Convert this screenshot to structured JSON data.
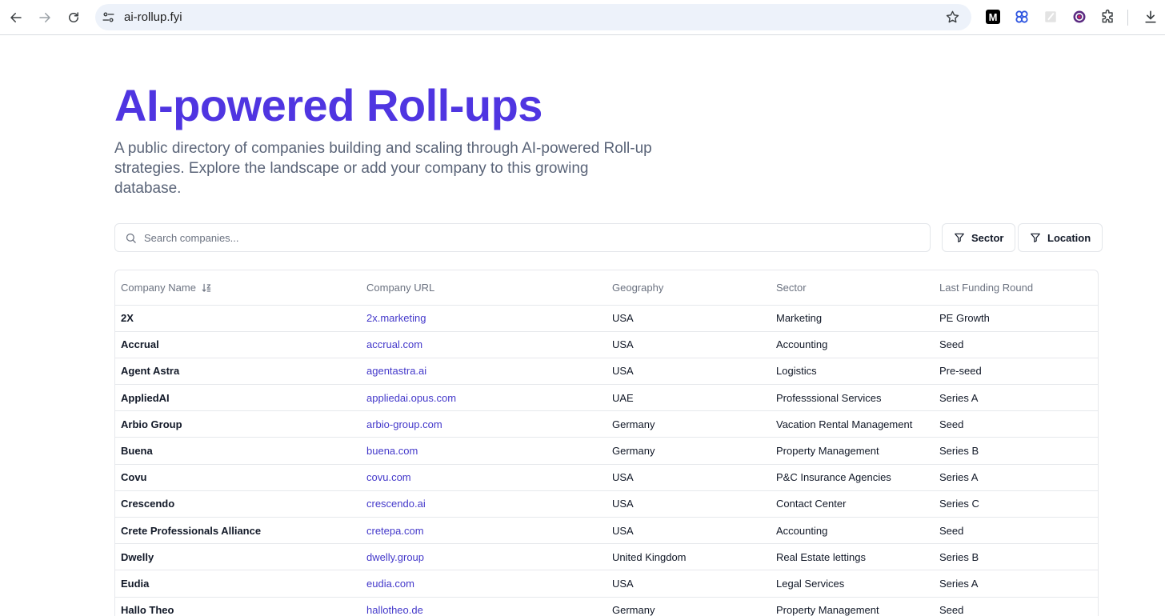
{
  "browser": {
    "url": "ai-rollup.fyi"
  },
  "hero": {
    "title": "AI-powered Roll-ups",
    "subtitle": "A public directory of companies building and scaling through AI-powered Roll-up strategies. Explore the landscape or add your company to this growing database."
  },
  "search": {
    "placeholder": "Search companies..."
  },
  "filters": {
    "sector_label": "Sector",
    "location_label": "Location"
  },
  "table": {
    "headers": {
      "name": "Company Name",
      "url": "Company URL",
      "geography": "Geography",
      "sector": "Sector",
      "funding": "Last Funding Round"
    },
    "rows": [
      {
        "name": "2X",
        "url": "2x.marketing",
        "geography": "USA",
        "sector": "Marketing",
        "funding": "PE Growth"
      },
      {
        "name": "Accrual",
        "url": "accrual.com",
        "geography": "USA",
        "sector": "Accounting",
        "funding": "Seed"
      },
      {
        "name": "Agent Astra",
        "url": "agentastra.ai",
        "geography": "USA",
        "sector": "Logistics",
        "funding": "Pre-seed"
      },
      {
        "name": "AppliedAI",
        "url": "appliedai.opus.com",
        "geography": "UAE",
        "sector": "Professsional Services",
        "funding": "Series A"
      },
      {
        "name": "Arbio Group",
        "url": "arbio-group.com",
        "geography": "Germany",
        "sector": "Vacation Rental Management",
        "funding": "Seed"
      },
      {
        "name": "Buena",
        "url": "buena.com",
        "geography": "Germany",
        "sector": "Property Management",
        "funding": "Series B"
      },
      {
        "name": "Covu",
        "url": "covu.com",
        "geography": "USA",
        "sector": "P&C Insurance Agencies",
        "funding": "Series A"
      },
      {
        "name": "Crescendo",
        "url": "crescendo.ai",
        "geography": "USA",
        "sector": "Contact Center",
        "funding": "Series C"
      },
      {
        "name": "Crete Professionals Alliance",
        "url": "cretepa.com",
        "geography": "USA",
        "sector": "Accounting",
        "funding": "Seed"
      },
      {
        "name": "Dwelly",
        "url": "dwelly.group",
        "geography": "United Kingdom",
        "sector": "Real Estate lettings",
        "funding": "Series B"
      },
      {
        "name": "Eudia",
        "url": "eudia.com",
        "geography": "USA",
        "sector": "Legal Services",
        "funding": "Series A"
      },
      {
        "name": "Hallo Theo",
        "url": "hallotheo.de",
        "geography": "Germany",
        "sector": "Property Management",
        "funding": "Seed"
      }
    ]
  },
  "colors": {
    "brand": "#4f35e1",
    "link": "#4338ca"
  }
}
